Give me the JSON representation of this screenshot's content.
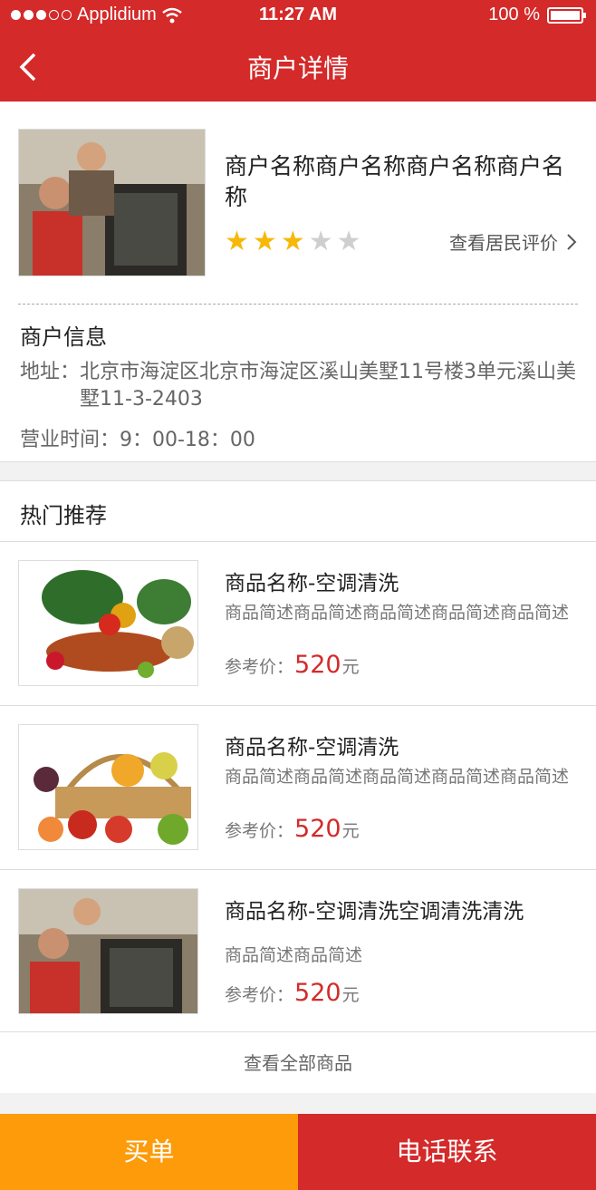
{
  "status_bar": {
    "carrier": "Applidium",
    "time": "11:27 AM",
    "battery": "100 %"
  },
  "nav": {
    "title": "商户详情"
  },
  "merchant": {
    "name": "商户名称商户名称商户名称商户名称",
    "rating": 3,
    "rating_max": 5,
    "review_link": "查看居民评价",
    "info_title": "商户信息",
    "address_label": "地址：",
    "address": "北京市海淀区北京市海淀区溪山美墅11号楼3单元溪山美墅11-3-2403",
    "hours": "营业时间：9：00-18：00"
  },
  "hot": {
    "title": "热门推荐",
    "price_label": "参考价：",
    "currency": "元",
    "items": [
      {
        "name": "商品名称-空调清洗",
        "desc": "商品简述商品简述商品简述商品简述商品简述",
        "price": "520"
      },
      {
        "name": "商品名称-空调清洗",
        "desc": "商品简述商品简述商品简述商品简述商品简述",
        "price": "520"
      },
      {
        "name": "商品名称-空调清洗空调清洗清洗",
        "desc": "商品简述商品简述",
        "price": "520"
      }
    ],
    "view_all": "查看全部商品"
  },
  "actions": {
    "buy": "买单",
    "call": "电话联系"
  },
  "colors": {
    "primary": "#d42a2a",
    "buy": "#fd9b0b",
    "star": "#f6b90a"
  }
}
